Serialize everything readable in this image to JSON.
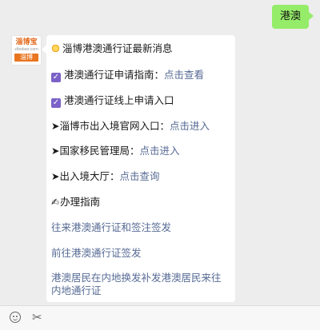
{
  "user_message": "港澳",
  "avatar": {
    "brand_top": "淄博宝",
    "brand_site": "zibobao.com",
    "brand_bottom": "淄博"
  },
  "reply": {
    "headline": "淄博港澳通行证最新消息",
    "item1": {
      "label": "港澳通行证申请指南：",
      "link": "点击查看"
    },
    "item2": {
      "label": "港澳通行证线上申请入口"
    },
    "item3": {
      "label": "➤淄博市出入境官网入口：",
      "link": "点击进入"
    },
    "item4": {
      "label": "➤国家移民管理局：",
      "link": "点击进入"
    },
    "item5": {
      "label": "➤出入境大厅：",
      "link": "点击查询"
    },
    "guide_title": "办理指南",
    "link_a": "往来港澳通行证和签注签发",
    "link_b": "前往港澳通行证签发",
    "link_c": "港澳居民在内地换发补发港澳居民来往内地通行证"
  },
  "icons": {
    "headline": "sun-icon",
    "check": "checkbox-icon",
    "guide": "writing-hand-icon",
    "emoji": "emoji-icon",
    "scissors": "scissors-icon"
  },
  "colors": {
    "bubble_out": "#95ec69",
    "link": "#576b95",
    "check": "#7b62c7",
    "background": "#ededed"
  }
}
